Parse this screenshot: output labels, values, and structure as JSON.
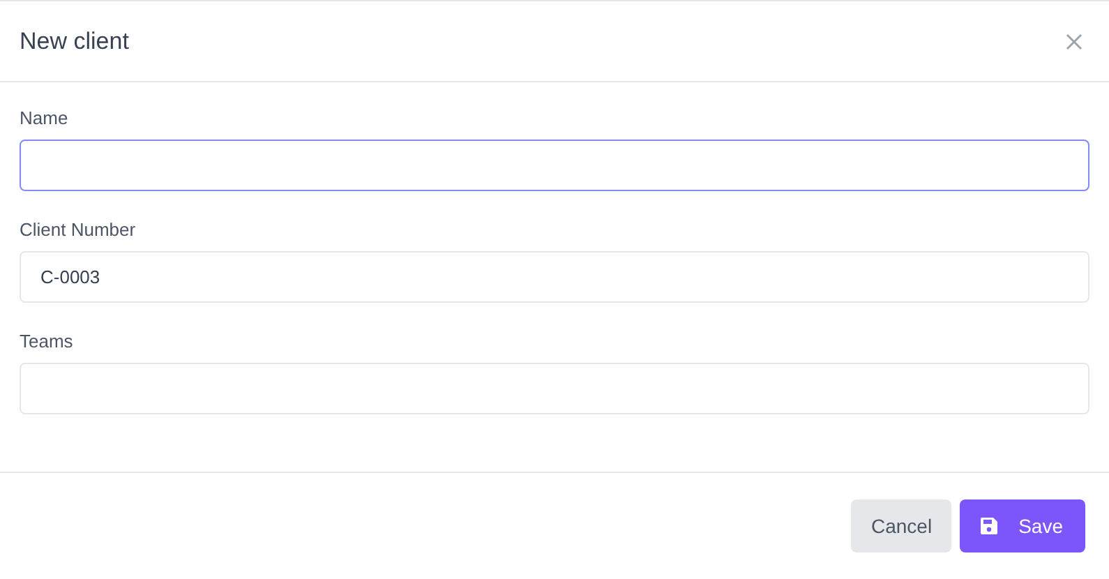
{
  "dialog": {
    "title": "New client"
  },
  "fields": [
    {
      "label": "Name",
      "focused": true
    },
    {
      "label": "Client Number",
      "value": "C-0003",
      "focused": false
    },
    {
      "label": "Teams",
      "focused": false
    }
  ],
  "buttons": [
    {
      "label": "Cancel",
      "kind": "secondary"
    },
    {
      "label": "Save",
      "kind": "primary"
    }
  ]
}
